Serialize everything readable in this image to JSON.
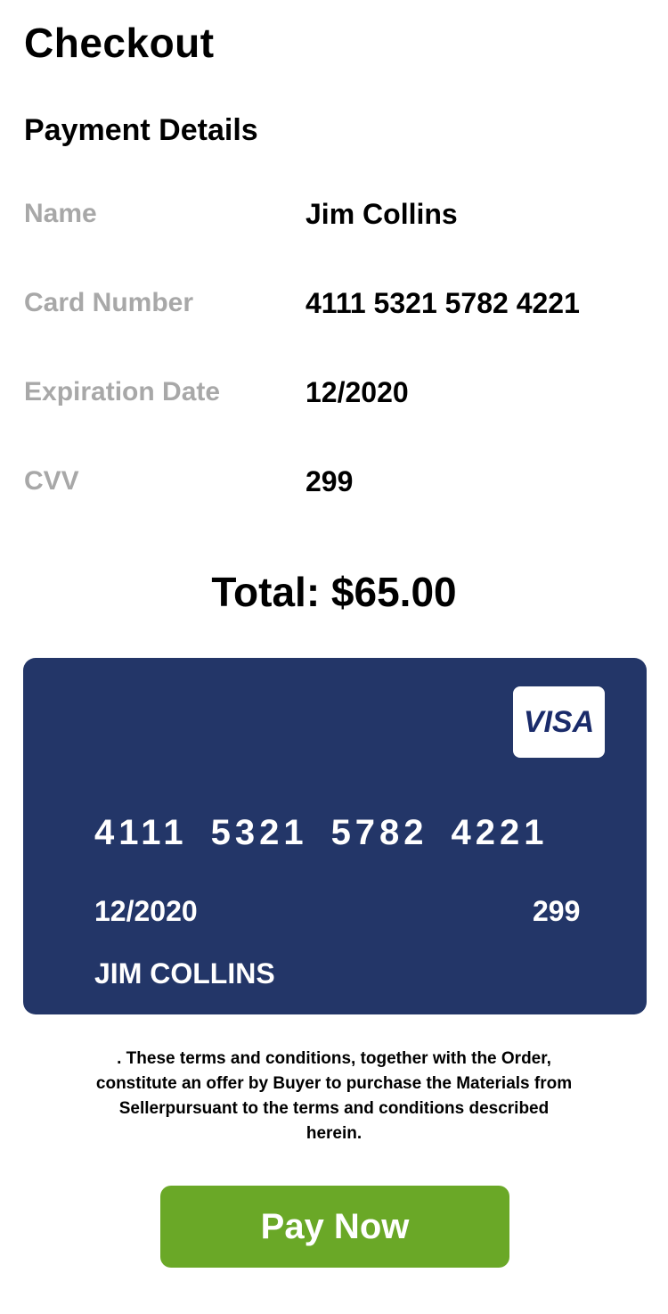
{
  "header": {
    "title": "Checkout"
  },
  "payment": {
    "section_title": "Payment Details",
    "fields": [
      {
        "label": "Name",
        "value": "Jim Collins"
      },
      {
        "label": "Card Number",
        "value": "4111 5321 5782 4221"
      },
      {
        "label": "Expiration Date",
        "value": "12/2020"
      },
      {
        "label": "CVV",
        "value": "299"
      }
    ]
  },
  "total": {
    "text": "Total: $65.00"
  },
  "card": {
    "brand": "VISA",
    "number_groups": [
      "4111",
      "5321",
      "5782",
      "4221"
    ],
    "expiry": "12/2020",
    "cvv": "299",
    "holder": "JIM COLLINS"
  },
  "terms": {
    "text": ". These terms and conditions, together with the Order, constitute an offer by Buyer to purchase the Materials from Sellerpursuant to the terms and conditions described herein."
  },
  "pay_button": {
    "label": "Pay Now"
  },
  "colors": {
    "card_background": "#233668",
    "visa_text": "#1a2b6a",
    "pay_button": "#6aa827",
    "label_gray": "#a8a8a8"
  }
}
